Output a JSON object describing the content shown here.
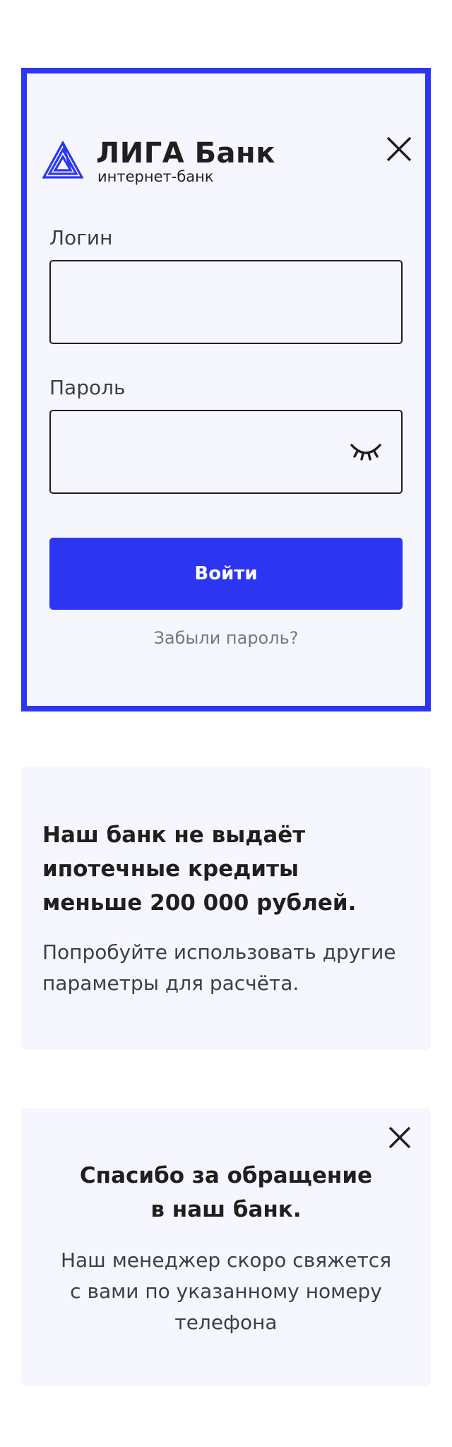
{
  "login_modal": {
    "brand_name": "ЛИГА Банк",
    "brand_subtitle": "интернет-банк",
    "login_label": "Логин",
    "login_value": "",
    "password_label": "Пароль",
    "password_value": "",
    "submit_label": "Войти",
    "forgot_link": "Забыли пароль?",
    "logo_icon": "liga-triangle-logo",
    "close_icon": "close-icon",
    "password_toggle_icon": "closed-eye-icon"
  },
  "info_card": {
    "title_lines": [
      "Наш банк не выдаёт",
      "ипотечные кредиты",
      "меньше 200 000 рублей."
    ],
    "text_lines": [
      "Попробуйте использовать другие",
      "параметры для расчёта."
    ]
  },
  "thanks_card": {
    "title_lines": [
      "Спасибо за обращение",
      "в наш банк."
    ],
    "text_lines": [
      "Наш менеджер скоро свяжется",
      "с вами по указанному номеру",
      "телефона"
    ],
    "close_icon": "close-icon"
  },
  "colors": {
    "accent": "#2c36f2",
    "card_background": "#f6f7fe",
    "text_primary": "#1f1f1f",
    "text_secondary": "#3b3f4a",
    "text_muted": "#727986"
  }
}
